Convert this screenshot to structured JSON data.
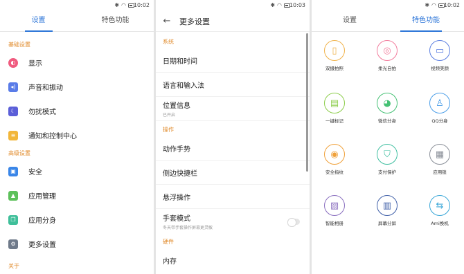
{
  "status": {
    "time_1": "10:02",
    "time_2": "10:03",
    "time_3": "10:02"
  },
  "panel1": {
    "tabs": [
      "设置",
      "特色功能"
    ],
    "sections": [
      {
        "title": "基础设置",
        "items": [
          {
            "label": "显示",
            "icon": "display-icon",
            "color": "#f05b7f"
          },
          {
            "label": "声音和振动",
            "icon": "sound-icon",
            "color": "#5a7ce8"
          },
          {
            "label": "勿扰模式",
            "icon": "moon-icon",
            "color": "#5b5fd8"
          },
          {
            "label": "通知和控制中心",
            "icon": "notification-icon",
            "color": "#f2b63a"
          }
        ]
      },
      {
        "title": "高级设置",
        "items": [
          {
            "label": "安全",
            "icon": "lock-icon",
            "color": "#3a86e8"
          },
          {
            "label": "应用管理",
            "icon": "android-icon",
            "color": "#5cc05a"
          },
          {
            "label": "应用分身",
            "icon": "clone-icon",
            "color": "#3fbf9a"
          },
          {
            "label": "更多设置",
            "icon": "gear-icon",
            "color": "#6f7a8a"
          }
        ]
      },
      {
        "title": "关于"
      }
    ]
  },
  "panel2": {
    "title": "更多设置",
    "sections": [
      {
        "title": "系统",
        "items": [
          {
            "label": "日期和时间"
          },
          {
            "label": "语言和输入法"
          },
          {
            "label": "位置信息",
            "sub": "已开启"
          }
        ]
      },
      {
        "title": "操作",
        "items": [
          {
            "label": "动作手势"
          },
          {
            "label": "侧边快捷栏"
          },
          {
            "label": "悬浮操作"
          },
          {
            "label": "手套模式",
            "sub": "冬天带手套操作屏幕更灵敏",
            "toggle": false
          }
        ]
      },
      {
        "title": "硬件",
        "items": [
          {
            "label": "内存"
          }
        ]
      }
    ]
  },
  "panel3": {
    "tabs": [
      "设置",
      "特色功能"
    ],
    "features": [
      {
        "label": "双摄拍照",
        "icon": "dual-camera-icon",
        "color": "#f0b24a"
      },
      {
        "label": "柔光自拍",
        "icon": "selfie-camera-icon",
        "color": "#f27a9b"
      },
      {
        "label": "视频美颜",
        "icon": "video-beauty-icon",
        "color": "#5b7ee0"
      },
      {
        "label": "一键标记",
        "icon": "mark-icon",
        "color": "#8ccd4a"
      },
      {
        "label": "微信分身",
        "icon": "wechat-icon",
        "color": "#45c174"
      },
      {
        "label": "QQ分身",
        "icon": "qq-icon",
        "color": "#4b9ee8"
      },
      {
        "label": "安全指纹",
        "icon": "fingerprint-icon",
        "color": "#f0a13a"
      },
      {
        "label": "支付保护",
        "icon": "payment-shield-icon",
        "color": "#3fbfa0"
      },
      {
        "label": "应用锁",
        "icon": "app-lock-icon",
        "color": "#8a8f98"
      },
      {
        "label": "智能相册",
        "icon": "smart-album-icon",
        "color": "#8a6fbf"
      },
      {
        "label": "屏幕分屏",
        "icon": "split-screen-icon",
        "color": "#3f5fa8"
      },
      {
        "label": "Ami换机",
        "icon": "phone-transfer-icon",
        "color": "#3aa7d8"
      }
    ]
  }
}
